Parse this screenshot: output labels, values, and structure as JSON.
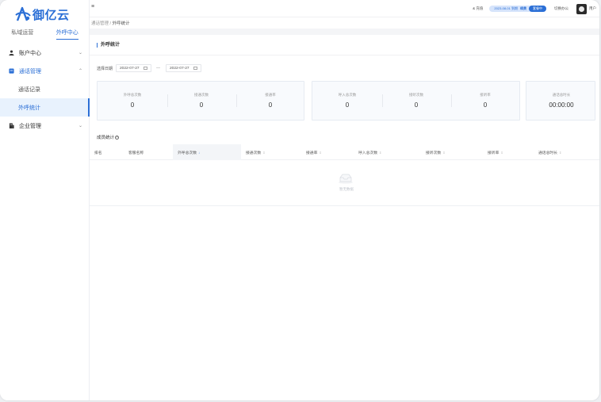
{
  "brand": {
    "name": "御亿云",
    "color": "#2b6fd6"
  },
  "sidebar": {
    "tabs": [
      {
        "label": "私域运营",
        "active": false
      },
      {
        "label": "外呼中心",
        "active": true
      }
    ],
    "menu": [
      {
        "label": "账户中心",
        "icon": "user-icon",
        "expanded": false
      },
      {
        "label": "通话管理",
        "icon": "call-manage-icon",
        "expanded": true,
        "children": [
          {
            "label": "通话记录",
            "active": false
          },
          {
            "label": "外呼统计",
            "active": true
          }
        ]
      },
      {
        "label": "企业管理",
        "icon": "building-icon",
        "expanded": false
      }
    ]
  },
  "header": {
    "phone": "& 充值",
    "package_date": "2023-08-01 到期",
    "renew": "续费",
    "renew_button": "套餐中",
    "workbench": "切换办公",
    "user": "用户"
  },
  "breadcrumb": {
    "parent": "通话管理",
    "current": "外呼统计"
  },
  "page": {
    "title": "外呼统计",
    "date_label": "选择日期",
    "date_start": "2022-07-27",
    "date_sep": "—",
    "date_end": "2022-07-27"
  },
  "stats": {
    "outbound": [
      {
        "label": "外呼总次数",
        "value": "0"
      },
      {
        "label": "接通次数",
        "value": "0"
      },
      {
        "label": "接通率",
        "value": "0"
      }
    ],
    "inbound": [
      {
        "label": "呼入总次数",
        "value": "0"
      },
      {
        "label": "接听次数",
        "value": "0"
      },
      {
        "label": "接听率",
        "value": "0"
      }
    ],
    "duration": {
      "label": "通话总时长",
      "value": "00:00:00"
    }
  },
  "members": {
    "title": "成员统计",
    "columns": [
      "排名",
      "客服名称",
      "外呼总次数",
      "接通次数",
      "接通率",
      "呼入总次数",
      "接听次数",
      "接听率",
      "通话总时长"
    ],
    "sorted_column": "外呼总次数",
    "empty_text": "暂无数据"
  }
}
